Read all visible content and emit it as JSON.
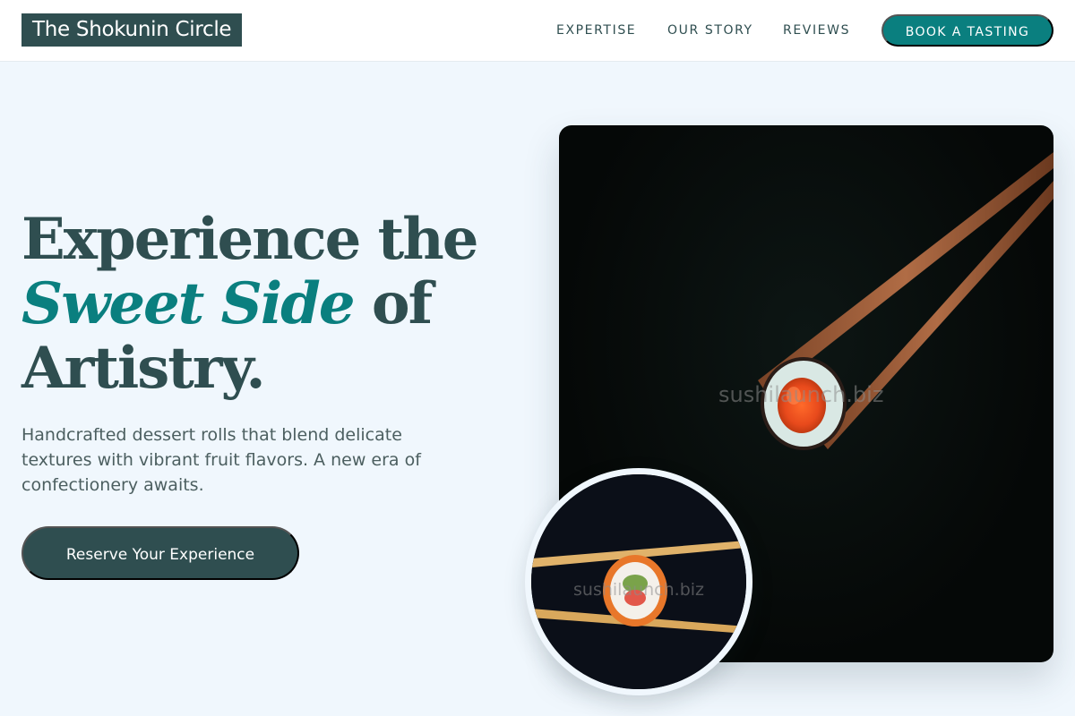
{
  "header": {
    "logo": "The Shokunin Circle",
    "nav": [
      "EXPERTISE",
      "OUR STORY",
      "REVIEWS"
    ],
    "cta": "BOOK A TASTING"
  },
  "hero": {
    "headline_line1": "Experience the",
    "headline_accent": "Sweet Side",
    "headline_of": " of",
    "headline_line3": "Artistry.",
    "subtext": "Handcrafted dessert rolls that blend delicate textures with vibrant fruit flavors. A new era of confectionery awaits.",
    "cta": "Reserve Your Experience"
  },
  "images": {
    "main_watermark": "sushilaunch.biz",
    "circle_watermark": "sushilaunch.biz"
  },
  "colors": {
    "primary_dark": "#2f4e50",
    "accent_teal": "#0a7f7f",
    "background": "#f0f7fd"
  }
}
